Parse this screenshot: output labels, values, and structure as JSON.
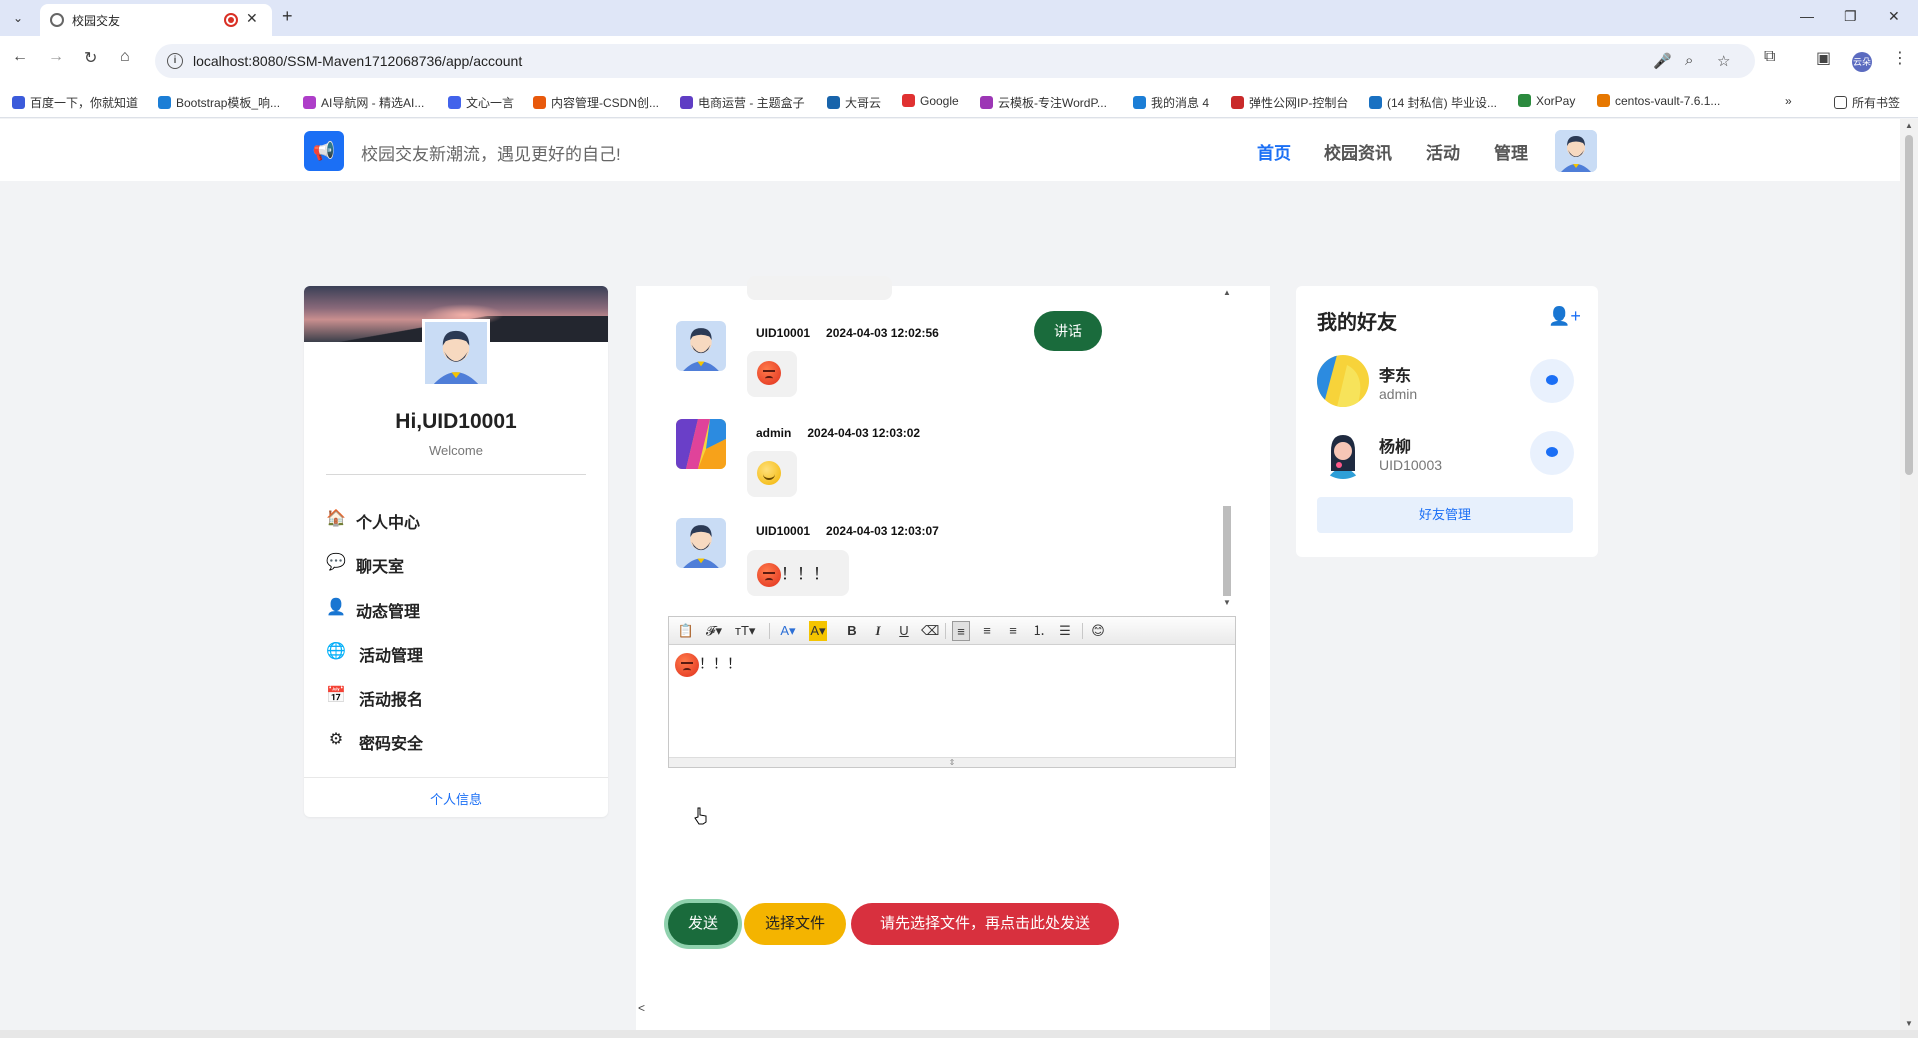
{
  "browser": {
    "tab_title": "校园交友",
    "url": "localhost:8080/SSM-Maven1712068736/app/account",
    "profile_label": "云朵",
    "bookmarks": [
      {
        "label": "百度一下，你就知道",
        "color": "#3b5bdb"
      },
      {
        "label": "Bootstrap模板_响...",
        "color": "#1c7ed6"
      },
      {
        "label": "AI导航网 - 精选AI...",
        "color": "#ae3ec9"
      },
      {
        "label": "文心一言",
        "color": "#4263eb"
      },
      {
        "label": "内容管理-CSDN创...",
        "color": "#e8590c"
      },
      {
        "label": "电商运营 - 主题盒子",
        "color": "#5f3dc4"
      },
      {
        "label": "大哥云",
        "color": "#1864ab"
      },
      {
        "label": "Google",
        "color": "#e03131"
      },
      {
        "label": "云模板-专注WordP...",
        "color": "#9c36b5"
      },
      {
        "label": "我的消息 4",
        "color": "#1c7ed6"
      },
      {
        "label": "弹性公网IP-控制台",
        "color": "#c92a2a"
      },
      {
        "label": "(14 封私信) 毕业设...",
        "color": "#1971c2"
      },
      {
        "label": "XorPay",
        "color": "#2b8a3e"
      },
      {
        "label": "centos-vault-7.6.1...",
        "color": "#e67700"
      }
    ],
    "all_bookmarks": "所有书签"
  },
  "header": {
    "slogan": "校园交友新潮流，遇见更好的自己!",
    "menu": [
      "首页",
      "校园资讯",
      "活动",
      "管理"
    ]
  },
  "profile": {
    "greeting": "Hi,UID10001",
    "welcome": "Welcome",
    "menu": [
      {
        "label": "个人中心",
        "icon": "home-icon"
      },
      {
        "label": "聊天室",
        "icon": "chat-icon"
      },
      {
        "label": "动态管理",
        "icon": "user-icon"
      },
      {
        "label": "活动管理",
        "icon": "globe-icon"
      },
      {
        "label": "活动报名",
        "icon": "calendar-icon"
      },
      {
        "label": "密码安全",
        "icon": "gear-icon"
      }
    ],
    "footer_link": "个人信息"
  },
  "chat": {
    "speak_label": "讲话",
    "messages": [
      {
        "user": "UID10001",
        "time": "2024-04-03 12:02:56",
        "content": ""
      },
      {
        "user": "admin",
        "time": "2024-04-03 12:03:02",
        "content": ""
      },
      {
        "user": "UID10001",
        "time": "2024-04-03 12:03:07",
        "content": "！！！"
      }
    ],
    "editor_text": "！！！",
    "send_label": "发送",
    "choose_file_label": "选择文件",
    "upload_label": "请先选择文件，再点击此处发送",
    "bottom_text": "<"
  },
  "friends": {
    "title": "我的好友",
    "list": [
      {
        "name": "李东",
        "uid": "admin"
      },
      {
        "name": "杨柳",
        "uid": "UID10003"
      }
    ],
    "manage_label": "好友管理"
  },
  "colors": {
    "accent": "#1b6ff5",
    "send": "#1a6b3c",
    "file": "#f4b400",
    "danger": "#d8303e"
  }
}
